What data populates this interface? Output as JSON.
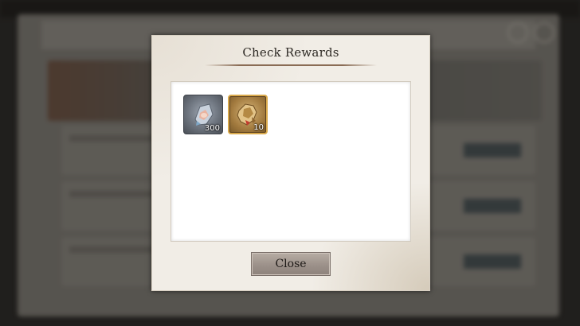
{
  "dialog": {
    "title": "Check Rewards",
    "rewards": [
      {
        "name": "gem-shard-icon",
        "quantity": "300",
        "frame_color": "#4a4f56"
      },
      {
        "name": "golden-fragment-icon",
        "quantity": "10",
        "frame_color": "#d9a94b"
      }
    ],
    "close_label": "Close"
  },
  "colors": {
    "dialog_bg": "#f1ede6",
    "content_bg": "#ffffff",
    "button_bg": "#9c918a",
    "title_rule": "#8a6c55"
  }
}
